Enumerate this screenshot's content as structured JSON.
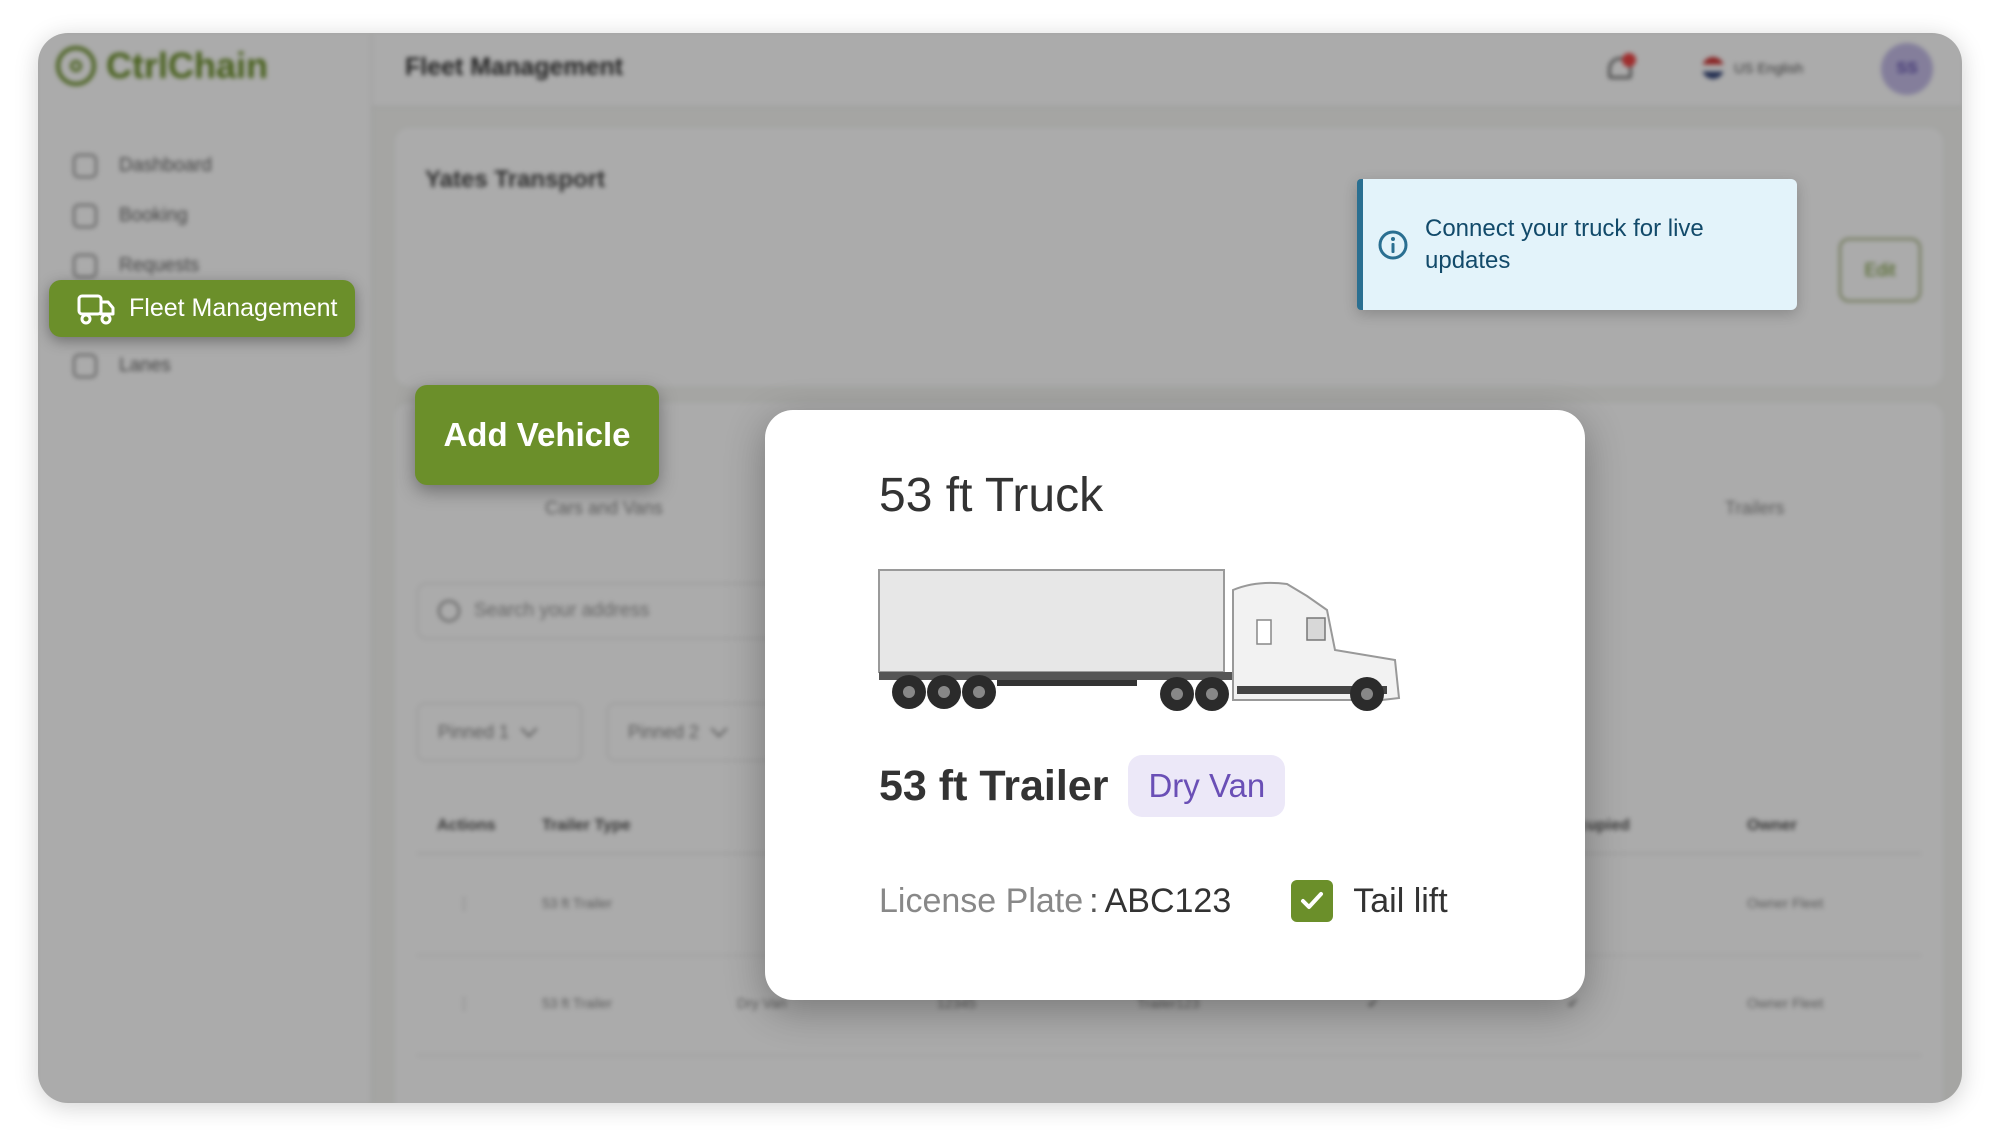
{
  "app": {
    "name": "CtrlChain",
    "page_title": "Fleet Management",
    "language": "US English",
    "avatar_initials": "SS"
  },
  "sidebar": {
    "items": [
      {
        "label": "Dashboard"
      },
      {
        "label": "Booking"
      },
      {
        "label": "Requests"
      },
      {
        "label": "Fleet Management",
        "active": true
      },
      {
        "label": "Lanes"
      }
    ]
  },
  "company": {
    "name": "Yates Transport",
    "edit_label": "Edit"
  },
  "toast": {
    "message": "Connect your truck for live updates"
  },
  "fleet": {
    "add_vehicle_label": "Add Vehicle",
    "tabs": [
      "Cars and Vans",
      "Trailers"
    ],
    "search_placeholder": "Search your address",
    "pinned": [
      "Pinned 1",
      "Pinned 2"
    ],
    "columns": [
      "Actions",
      "Trailer Type",
      "Occupied",
      "Owner"
    ],
    "rows": [
      {
        "type": "53 ft Trailer",
        "owner": "Owner Fleet"
      },
      {
        "type": "53 ft Trailer",
        "subtype": "Dry Van",
        "id": "12345",
        "plate": "Trailer123",
        "owner": "Owner Fleet"
      }
    ]
  },
  "modal": {
    "title": "53 ft Truck",
    "trailer_name": "53 ft Trailer",
    "trailer_type": "Dry Van",
    "license_label": "License Plate",
    "license_sep": ":",
    "license_value": "ABC123",
    "tail_lift_label": "Tail lift",
    "tail_lift_checked": true
  },
  "colors": {
    "brand_green": "#6b8f2a",
    "toast_accent": "#2a6f91",
    "badge_purple": "#6a4fb6"
  }
}
